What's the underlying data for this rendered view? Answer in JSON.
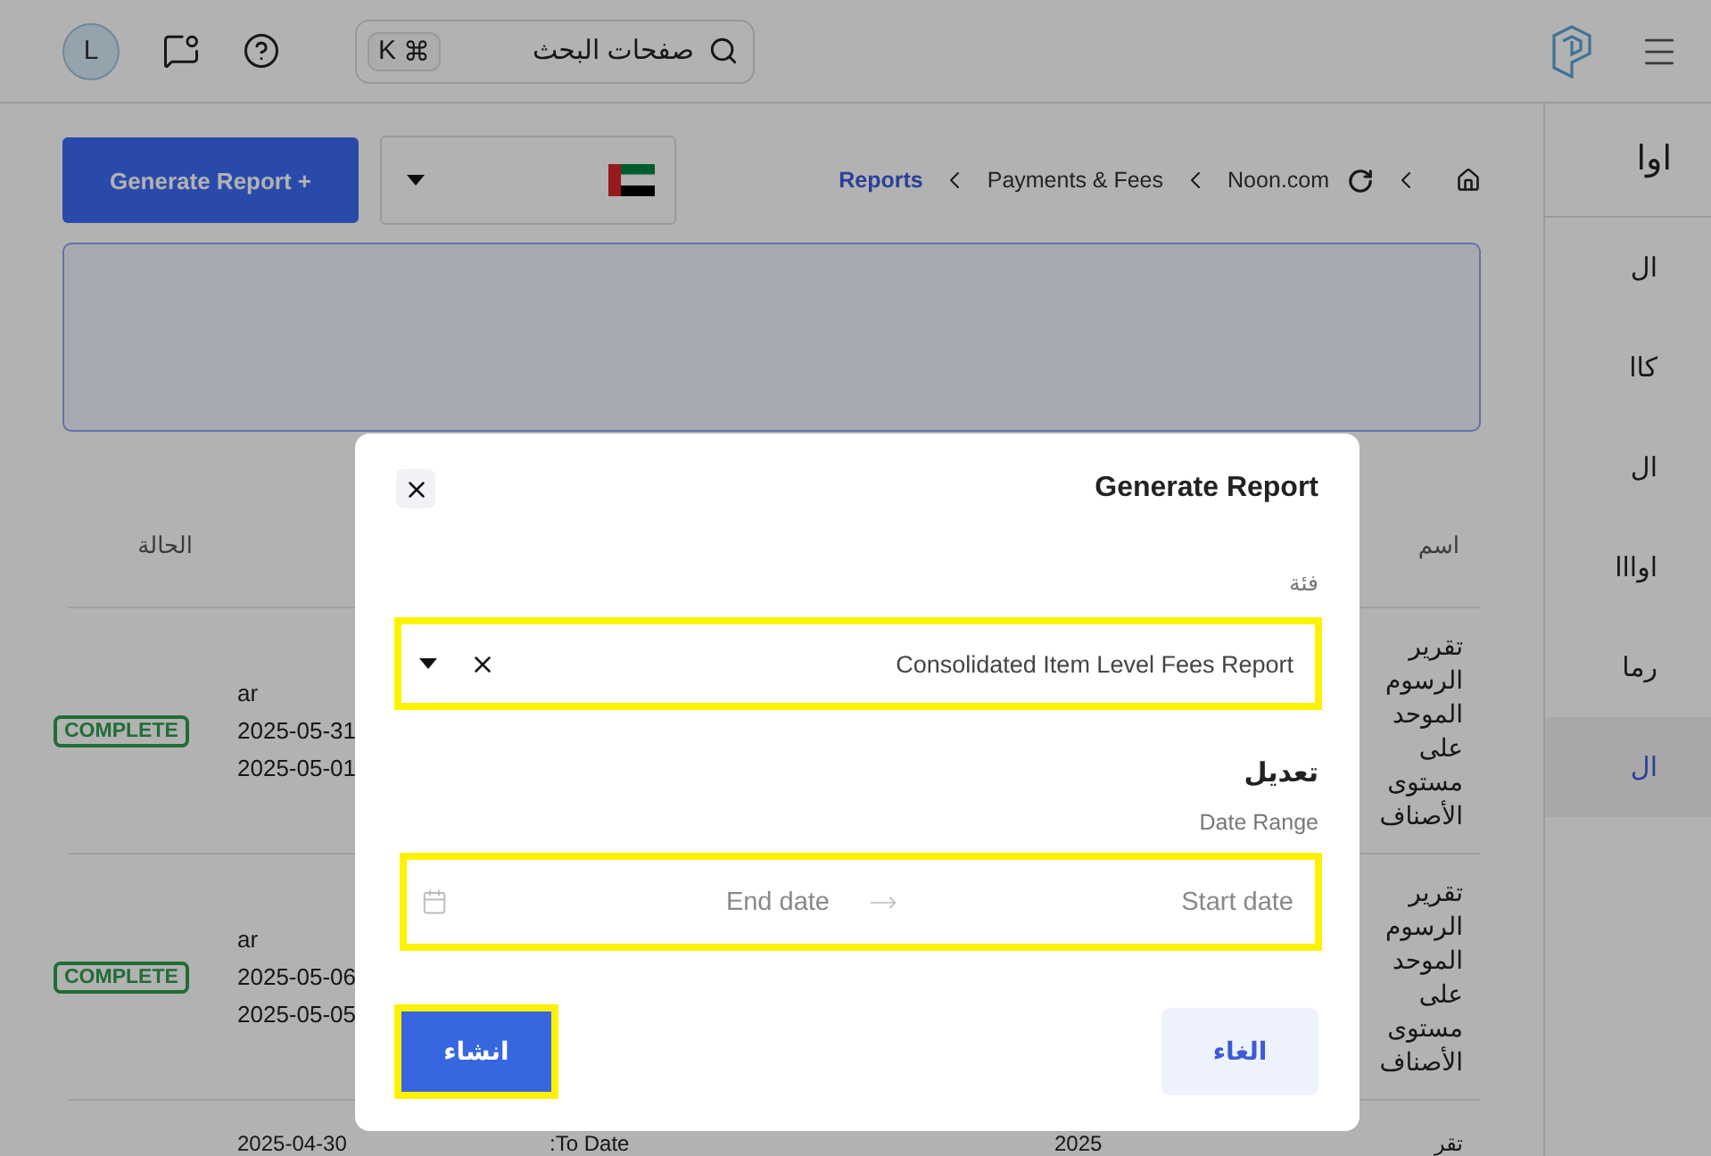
{
  "header": {
    "avatar": "L",
    "search": {
      "placeholder": "صفحات البحث",
      "shortcut_symbol": "⌘",
      "shortcut_key": "K"
    }
  },
  "sidebar": {
    "title": "اوا",
    "items": [
      {
        "label": "ال",
        "selected": false
      },
      {
        "label": "كاا",
        "selected": false
      },
      {
        "label": "ال",
        "selected": false
      },
      {
        "label": "اوااا",
        "selected": false
      },
      {
        "label": "رما",
        "selected": false
      },
      {
        "label": "ال",
        "selected": true
      }
    ]
  },
  "toolbar": {
    "generate_button": "Generate Report +"
  },
  "breadcrumbs": [
    {
      "label": "Noon.com",
      "current": false
    },
    {
      "label": "Payments & Fees",
      "current": false
    },
    {
      "label": "Reports",
      "current": true
    }
  ],
  "table": {
    "status_heading": "الحالة",
    "name_heading": "اسم",
    "rows": [
      {
        "status": "COMPLETE",
        "language": "ar",
        "end_date": "2025-05-31",
        "start_date": "2025-05-01",
        "name": "تقرير الرسوم الموحد على مستوى الأصناف"
      },
      {
        "status": "COMPLETE",
        "language": "ar",
        "end_date": "2025-05-06",
        "start_date": "2025-05-05",
        "name": "تقرير الرسوم الموحد على مستوى الأصناف"
      },
      {
        "date": "2025-04-30",
        "column_3": "To Date:",
        "column_4": "2025",
        "name": "تقر"
      }
    ]
  },
  "modal": {
    "title": "Generate Report",
    "category": {
      "label": "فئة",
      "value": "Consolidated Item Level Fees Report",
      "highlighted": true
    },
    "section_title": "تعديل",
    "date_range": {
      "label": "Date Range",
      "start_placeholder": "Start date",
      "end_placeholder": "End date",
      "highlighted": true
    },
    "buttons": [
      {
        "label": "الغاء",
        "kind": "secondary",
        "highlighted": false
      },
      {
        "label": "انشاء",
        "kind": "primary",
        "highlighted": true
      }
    ]
  }
}
